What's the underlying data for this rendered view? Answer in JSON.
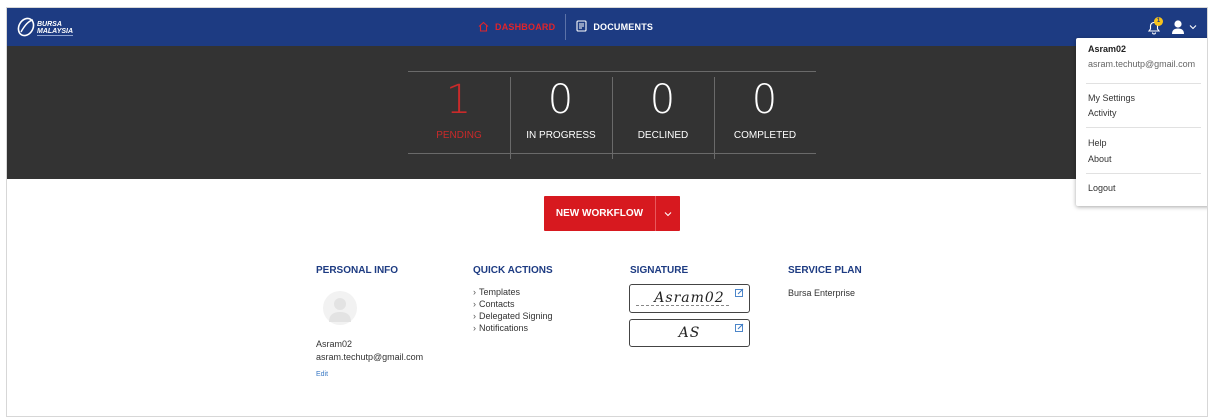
{
  "nav": {
    "dashboard_label": "DASHBOARD",
    "documents_label": "DOCUMENTS",
    "notification_count": "1",
    "logo_name": "bursa-malaysia-logo"
  },
  "stats": [
    {
      "count": "1",
      "label": "PENDING"
    },
    {
      "count": "0",
      "label": "IN PROGRESS"
    },
    {
      "count": "0",
      "label": "DECLINED"
    },
    {
      "count": "0",
      "label": "COMPLETED"
    }
  ],
  "workflow": {
    "button_label": "NEW WORKFLOW"
  },
  "personal_info": {
    "title": "PERSONAL INFO",
    "username": "Asram02",
    "email": "asram.techutp@gmail.com",
    "edit_label": "Edit"
  },
  "quick_actions": {
    "title": "QUICK ACTIONS",
    "items": [
      "Templates",
      "Contacts",
      "Delegated Signing",
      "Notifications"
    ]
  },
  "signature": {
    "title": "SIGNATURE",
    "full_signature": "Asram02",
    "initials": "AS"
  },
  "service_plan": {
    "title": "SERVICE PLAN",
    "plan": "Bursa Enterprise"
  },
  "user_menu": {
    "name": "Asram02",
    "email": "asram.techutp@gmail.com",
    "items": [
      "My Settings",
      "Activity",
      "Help",
      "About",
      "Logout"
    ]
  },
  "colors": {
    "nav_bg": "#1d3b82",
    "accent_red": "#d7191f",
    "stats_bg": "#333333",
    "badge": "#f7c21b"
  }
}
